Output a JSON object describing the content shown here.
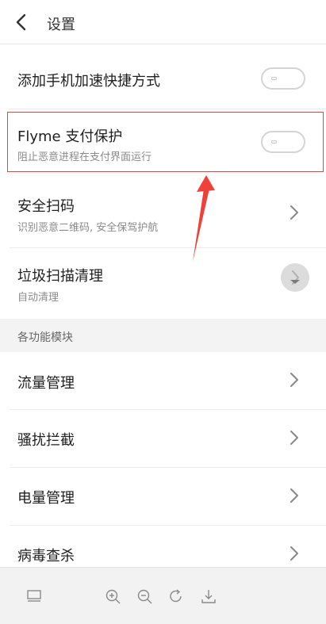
{
  "header": {
    "title": "设置",
    "back_icon": "chevron-left-icon"
  },
  "rows": {
    "phone_speed": {
      "title": "添加手机加速快捷方式",
      "toggle_on": false
    },
    "flyme_pay": {
      "title": "Flyme 支付保护",
      "subtitle": "阻止恶意进程在支付界面运行",
      "toggle_on": false
    },
    "safe_scan": {
      "title": "安全扫码",
      "subtitle": "识别恶意二维码, 安全保驾护航"
    },
    "junk_clean": {
      "title": "垃圾扫描清理",
      "subtitle": "自动清理"
    }
  },
  "section": {
    "title": "各功能模块"
  },
  "modules": [
    {
      "title": "流量管理"
    },
    {
      "title": "骚扰拦截"
    },
    {
      "title": "电量管理"
    },
    {
      "title": "病毒查杀"
    }
  ],
  "toolbar": {
    "icons": [
      "fit-screen-icon",
      "zoom-in-icon",
      "zoom-out-icon",
      "rotate-icon",
      "download-icon"
    ]
  },
  "colors": {
    "highlight": "#e0453f",
    "accent_red": "#f0403a",
    "divider": "#ececec"
  }
}
